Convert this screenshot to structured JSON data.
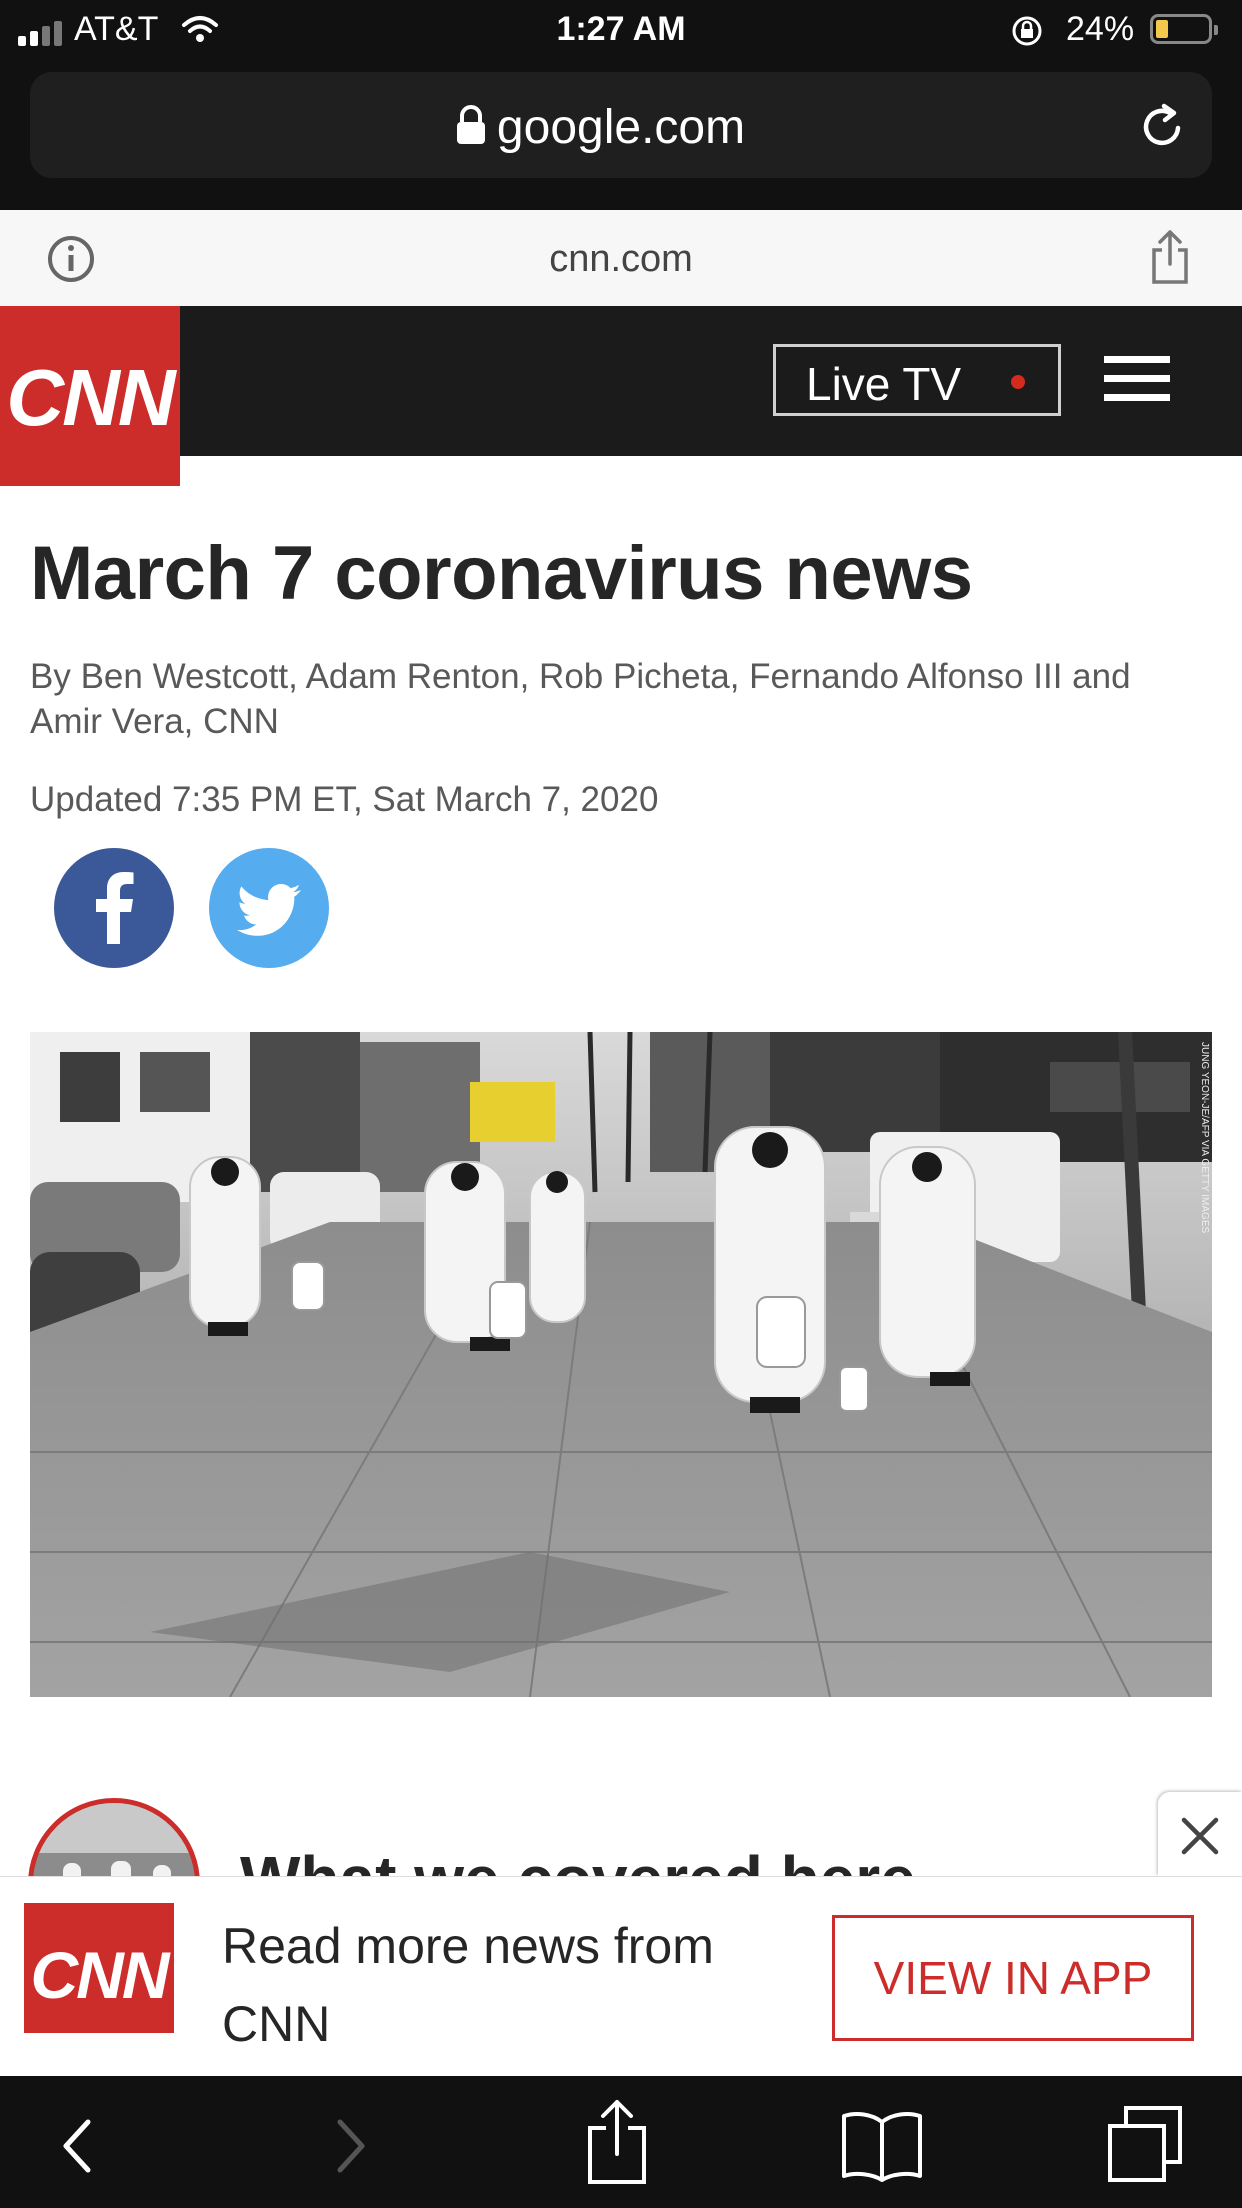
{
  "status": {
    "carrier": "AT&T",
    "time": "1:27 AM",
    "battery_pct": "24%",
    "battery_level": 0.24
  },
  "browser": {
    "url": "google.com"
  },
  "amp_bar": {
    "host": "cnn.com"
  },
  "cnn_header": {
    "logo_text": "CNN",
    "live_tv_label": "Live TV",
    "live_dot_color": "#d52b1e"
  },
  "article": {
    "title": "March 7 coronavirus news",
    "byline": "By Ben Westcott, Adam Renton, Rob Picheta, Fernando Alfonso III and Amir Vera, CNN",
    "updated": "Updated 7:35 PM ET, Sat March 7, 2020",
    "photo_credit": "JUNG YEON-JE/AFP VIA GETTY IMAGES"
  },
  "section": {
    "covered_heading": "What we covered here"
  },
  "app_banner": {
    "logo_text": "CNN",
    "text": "Read more news from CNN",
    "button_label": "VIEW IN APP"
  },
  "colors": {
    "cnn_red": "#cc2d2a",
    "facebook": "#3b5998",
    "twitter": "#55acee",
    "header_bg": "#1b1b1b"
  }
}
